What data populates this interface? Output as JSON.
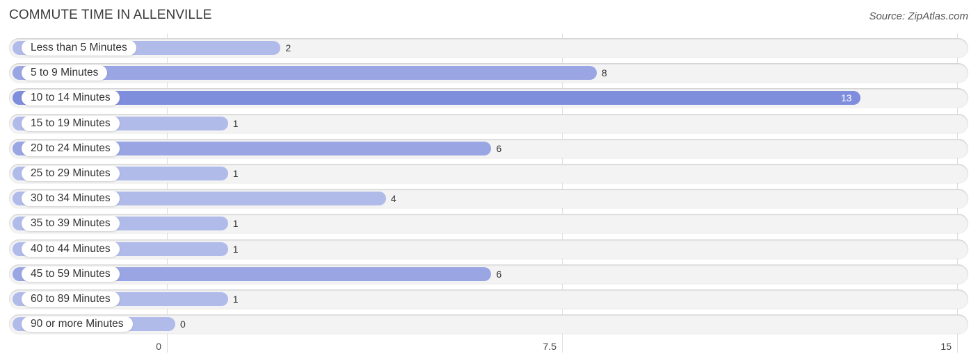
{
  "header": {
    "title": "COMMUTE TIME IN ALLENVILLE",
    "source": "Source: ZipAtlas.com"
  },
  "colors": {
    "bar_light": "#b1bbea",
    "bar_mid": "#9aa6e3",
    "bar_dark": "#7f8ddd",
    "track": "#f3f3f3"
  },
  "chart_data": {
    "type": "bar",
    "orientation": "horizontal",
    "title": "COMMUTE TIME IN ALLENVILLE",
    "xlabel": "",
    "ylabel": "",
    "xlim": [
      0,
      15
    ],
    "grid": true,
    "categories": [
      "Less than 5 Minutes",
      "5 to 9 Minutes",
      "10 to 14 Minutes",
      "15 to 19 Minutes",
      "20 to 24 Minutes",
      "25 to 29 Minutes",
      "30 to 34 Minutes",
      "35 to 39 Minutes",
      "40 to 44 Minutes",
      "45 to 59 Minutes",
      "60 to 89 Minutes",
      "90 or more Minutes"
    ],
    "values": [
      2,
      8,
      13,
      1,
      6,
      1,
      4,
      1,
      1,
      6,
      1,
      0
    ],
    "tick_labels": [
      "0",
      "7.5",
      "15"
    ],
    "tick_values": [
      0,
      7.5,
      15
    ]
  }
}
